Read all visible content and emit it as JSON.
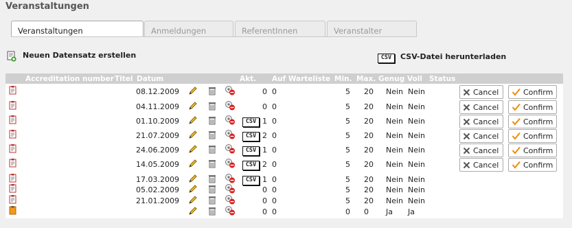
{
  "page_title": "Veranstaltungen",
  "tabs": [
    {
      "label": "Veranstaltungen",
      "active": true
    },
    {
      "label": "Anmeldungen",
      "active": false
    },
    {
      "label": "ReferentInnen",
      "active": false
    },
    {
      "label": "Veranstalter",
      "active": false
    }
  ],
  "actions": {
    "new_record": "Neuen Datensatz erstellen",
    "csv_download": "CSV-Datei herunterladen",
    "csv_badge": "CSV"
  },
  "columns": [
    "Accreditation number",
    "Titel",
    "Datum",
    "Akt.",
    "Auf Warteliste",
    "Min.",
    "Max.",
    "Genug",
    "Voll",
    "Status"
  ],
  "rows": [
    {
      "datum": "08.12.2009",
      "csv": false,
      "akt": "0",
      "warteliste": "0",
      "min": "5",
      "max": "20",
      "genug": "Nein",
      "voll": "Nein",
      "buttons": true
    },
    {
      "datum": "04.11.2009",
      "csv": false,
      "akt": "0",
      "warteliste": "0",
      "min": "5",
      "max": "20",
      "genug": "Nein",
      "voll": "Nein",
      "buttons": true
    },
    {
      "datum": "01.10.2009",
      "csv": true,
      "akt": "1",
      "warteliste": "0",
      "min": "5",
      "max": "20",
      "genug": "Nein",
      "voll": "Nein",
      "buttons": true
    },
    {
      "datum": "21.07.2009",
      "csv": true,
      "akt": "2",
      "warteliste": "0",
      "min": "5",
      "max": "20",
      "genug": "Nein",
      "voll": "Nein",
      "buttons": true
    },
    {
      "datum": "24.06.2009",
      "csv": true,
      "akt": "1",
      "warteliste": "0",
      "min": "5",
      "max": "20",
      "genug": "Nein",
      "voll": "Nein",
      "buttons": true
    },
    {
      "datum": "14.05.2009",
      "csv": true,
      "akt": "2",
      "warteliste": "0",
      "min": "5",
      "max": "20",
      "genug": "Nein",
      "voll": "Nein",
      "buttons": true
    },
    {
      "datum": "17.03.2009",
      "csv": true,
      "akt": "1",
      "warteliste": "0",
      "min": "5",
      "max": "20",
      "genug": "Nein",
      "voll": "Nein",
      "buttons": false
    },
    {
      "datum": "05.02.2009",
      "csv": false,
      "akt": "0",
      "warteliste": "0",
      "min": "5",
      "max": "20",
      "genug": "Nein",
      "voll": "Nein",
      "buttons": false
    },
    {
      "datum": "21.01.2009",
      "csv": false,
      "akt": "0",
      "warteliste": "0",
      "min": "5",
      "max": "20",
      "genug": "Nein",
      "voll": "Nein",
      "buttons": false
    },
    {
      "datum": "",
      "csv": false,
      "akt": "0",
      "warteliste": "0",
      "min": "0",
      "max": "0",
      "genug": "Ja",
      "voll": "Ja",
      "buttons": false
    }
  ],
  "button_labels": {
    "cancel": "Cancel",
    "confirm": "Confirm"
  },
  "icons": {
    "row": "clipboard-icon",
    "edit": "pencil-icon",
    "delete": "trash-icon",
    "hide": "hide-record-icon",
    "new": "new-record-icon"
  },
  "colors": {
    "header_bg": "#cfcfcf",
    "confirm_check": "#f08a00",
    "cancel_x": "#555555",
    "delete_badge": "#d81e1e"
  }
}
